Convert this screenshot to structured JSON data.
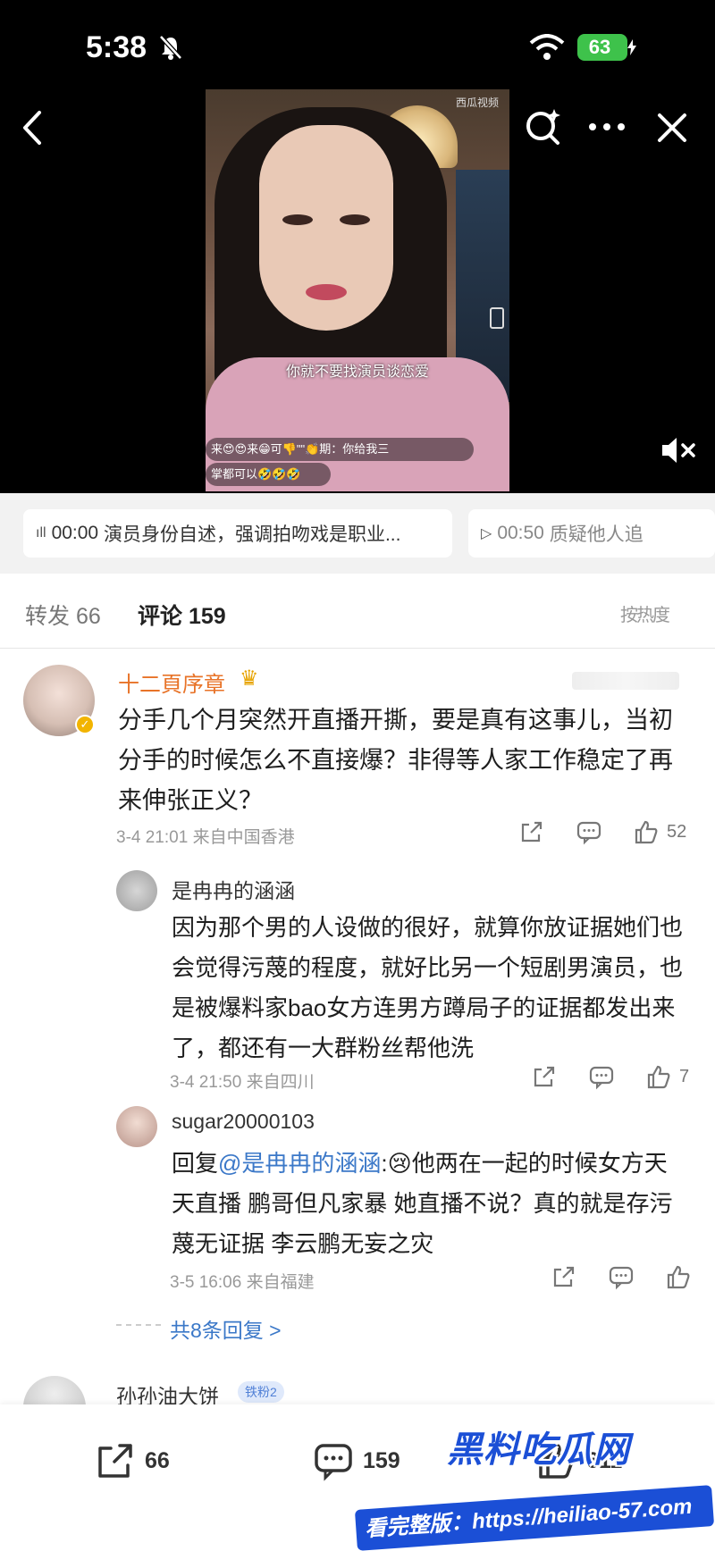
{
  "status_bar": {
    "time": "5:38",
    "battery": "63"
  },
  "video": {
    "watermark": "西瓜视频",
    "subtitle": "你就不要找演员谈恋爱",
    "live_comment_1": "来😍😍来😁可👎\"\"👏期：你给我三",
    "live_comment_2": "掌都可以🤣🤣🤣"
  },
  "chapters": [
    {
      "time": "00:00",
      "label": "演员身份自述，强调拍吻戏是职业..."
    },
    {
      "time": "00:50",
      "label": "质疑他人追"
    }
  ],
  "tabs": {
    "repost": "转发 66",
    "comment": "评论 159",
    "sort": "按热度"
  },
  "comments": [
    {
      "name": "十二頁序章",
      "body": "分手几个月突然开直播开撕，要是真有这事儿，当初分手的时候怎么不直接爆？非得等人家工作稳定了再来伸张正义？",
      "meta": "3-4 21:01 来自中国香港",
      "likes": "52"
    },
    {
      "name": "是冉冉的涵涵",
      "body": "因为那个男的人设做的很好，就算你放证据她们也会觉得污蔑的程度，就好比另一个短剧男演员，也是被爆料家bao女方连男方蹲局子的证据都发出来了，都还有一大群粉丝帮他洗",
      "meta": "3-4 21:50 来自四川",
      "likes": "7"
    },
    {
      "name": "sugar20000103",
      "reply_prefix": "回复",
      "mention": "@是冉冉的涵涵",
      "body": ":😢他两在一起的时候女方天天直播 鹏哥但凡家暴 她直播不说？真的就是存污蔑无证据 李云鹏无妄之灾",
      "meta": "3-5 16:06 来自福建"
    }
  ],
  "more_replies": "共8条回复 >",
  "next_comment": {
    "name": "孙孙油大饼",
    "badge": "铁粉2"
  },
  "bottom_bar": {
    "share": "66",
    "comment": "159",
    "like": "611"
  },
  "watermark": {
    "title": "黑料吃瓜网",
    "url": "看完整版：https://heiliao-57.com"
  }
}
